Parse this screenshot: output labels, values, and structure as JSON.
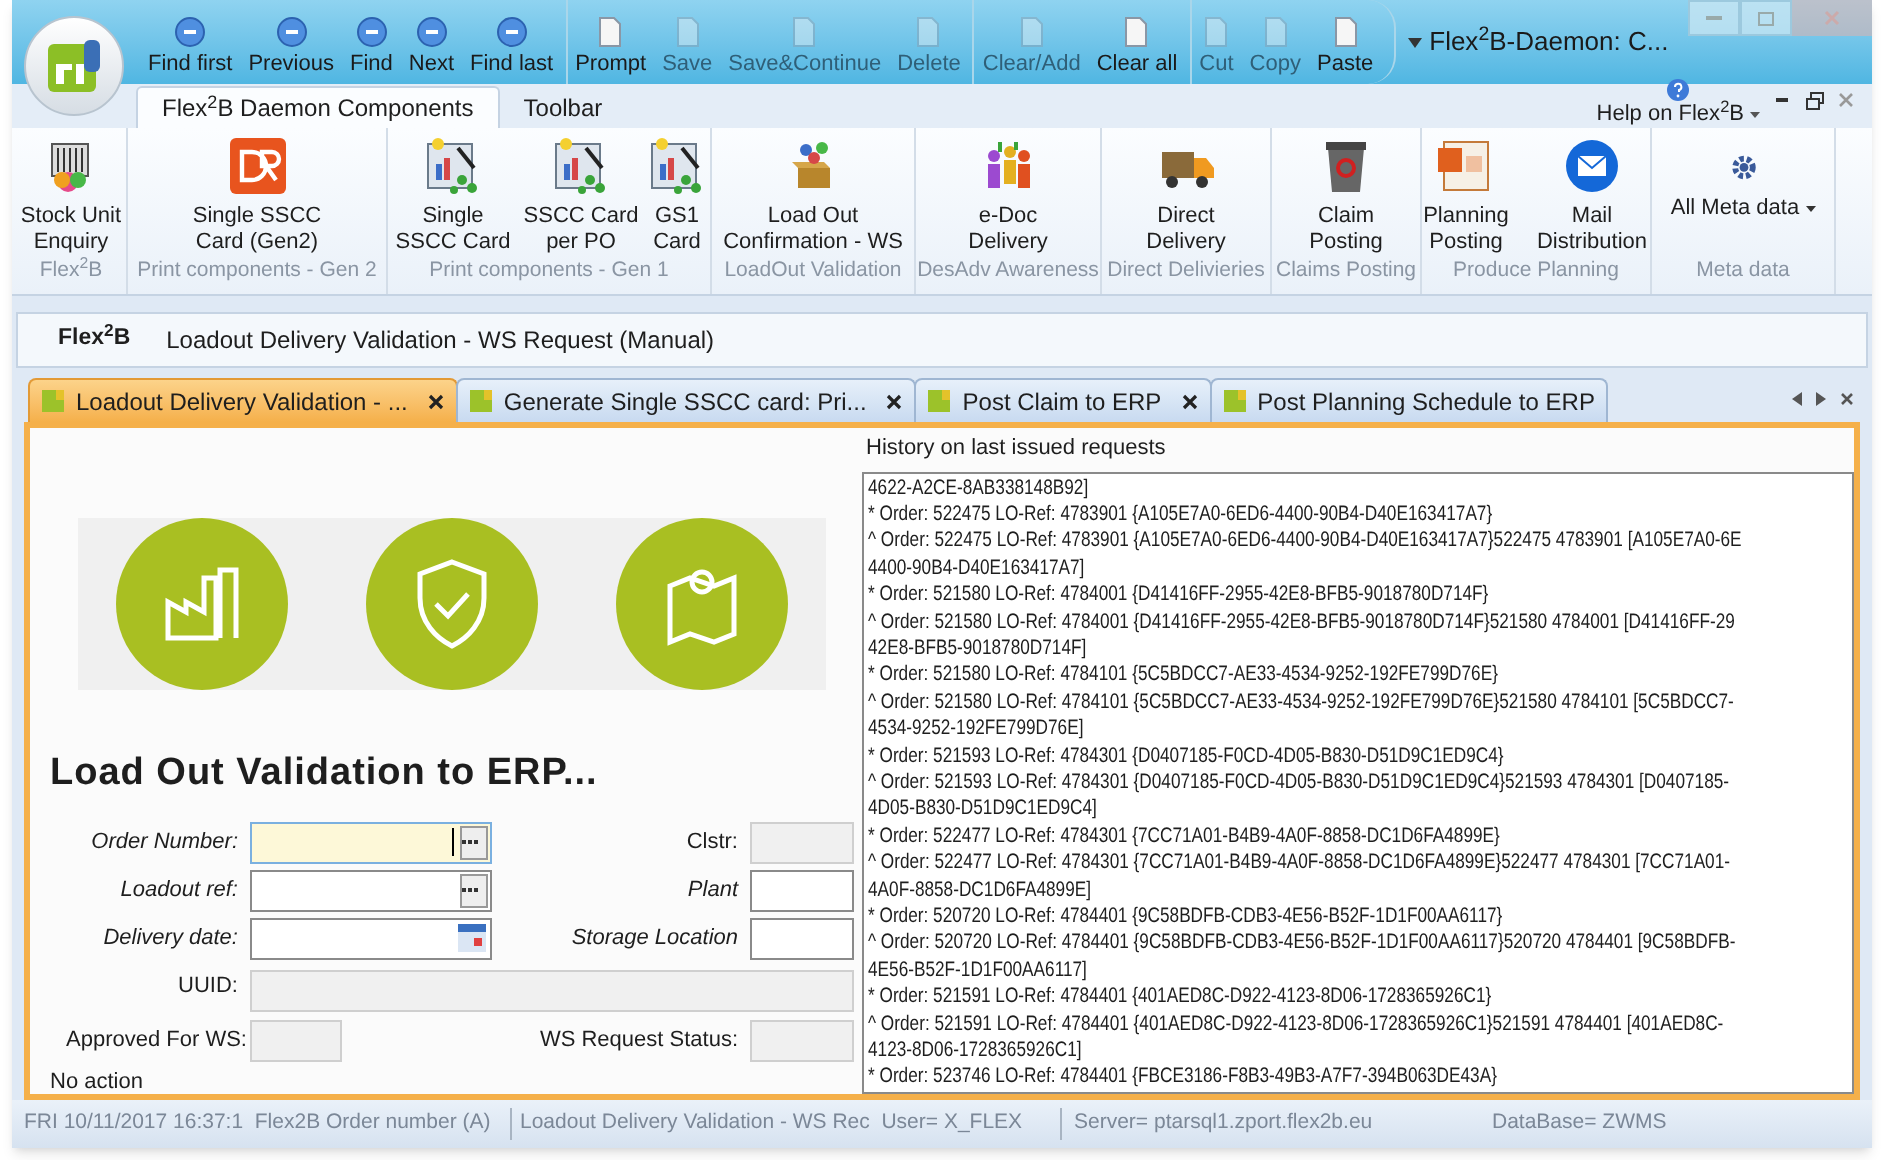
{
  "window": {
    "title": "Flex$^{2}$B-Daemon: C..."
  },
  "quick_access": [
    [
      {
        "label": "Find first",
        "disabled": false
      },
      {
        "label": "Previous",
        "disabled": false
      },
      {
        "label": "Find",
        "disabled": false
      },
      {
        "label": "Next",
        "disabled": false
      },
      {
        "label": "Find last",
        "disabled": false
      }
    ],
    [
      {
        "label": "Prompt",
        "disabled": false
      },
      {
        "label": "Save",
        "disabled": true
      },
      {
        "label": "Save&Continue",
        "disabled": true
      },
      {
        "label": "Delete",
        "disabled": true
      }
    ],
    [
      {
        "label": "Clear/Add",
        "disabled": true
      },
      {
        "label": "Clear all",
        "disabled": false
      }
    ],
    [
      {
        "label": "Cut",
        "disabled": true
      },
      {
        "label": "Copy",
        "disabled": true
      },
      {
        "label": "Paste",
        "disabled": false
      }
    ]
  ],
  "ribbon_tabs": [
    {
      "label": "Flex$^{2}$B Daemon Components",
      "selected": true
    },
    {
      "label": "Toolbar",
      "selected": false
    }
  ],
  "help": {
    "label": "Help on Flex$^{2}$B"
  },
  "ribbon_groups": [
    {
      "label": "Flex$^{2}$B",
      "buttons": [
        {
          "label": "Stock Unit Enquiry"
        }
      ]
    },
    {
      "label": "Print components - Gen 2",
      "buttons": [
        {
          "label": "Single SSCC Card (Gen2)"
        }
      ]
    },
    {
      "label": "Print components - Gen 1",
      "buttons": [
        {
          "label": "Single SSCC Card"
        },
        {
          "label": "SSCC Card per PO"
        },
        {
          "label": "GS1 Card"
        }
      ]
    },
    {
      "label": "LoadOut Validation",
      "buttons": [
        {
          "label": "Load Out Confirmation - WS"
        }
      ]
    },
    {
      "label": "DesAdv Awareness",
      "buttons": [
        {
          "label": "e-Doc Delivery"
        }
      ]
    },
    {
      "label": "Direct Delivieries",
      "buttons": [
        {
          "label": "Direct Delivery"
        }
      ]
    },
    {
      "label": "Claims Posting",
      "buttons": [
        {
          "label": "Claim Posting"
        }
      ]
    },
    {
      "label": "Produce Planning",
      "buttons": [
        {
          "label": "Planning Posting"
        },
        {
          "label": "Mail Distribution"
        }
      ]
    },
    {
      "label": "Meta data",
      "buttons": [
        {
          "label": "All Meta data",
          "dropdown": true
        }
      ]
    }
  ],
  "header": {
    "brand": "Flex$^{2}$B",
    "title": "Loadout Delivery Validation - WS Request (Manual)"
  },
  "doc_tabs": [
    {
      "label": "Loadout Delivery Validation - ...",
      "selected": true,
      "closable": true
    },
    {
      "label": "Generate Single SSCC card: Pri...",
      "selected": false,
      "closable": true
    },
    {
      "label": "Post Claim to ERP",
      "selected": false,
      "closable": true
    },
    {
      "label": "Post Planning Schedule to ERP",
      "selected": false,
      "closable": false
    }
  ],
  "form": {
    "title": "Load Out Validation to ERP...",
    "rows": [
      {
        "kind": "pair",
        "left": {
          "label": "Order Number:",
          "required": true,
          "kind": "lookup",
          "focused": true,
          "disabled": false
        },
        "right": {
          "label": "Clstr:",
          "required": false,
          "focused": false,
          "disabled": true
        }
      },
      {
        "kind": "pair",
        "left": {
          "label": "Loadout ref:",
          "required": true,
          "kind": "lookup",
          "focused": false,
          "disabled": false
        },
        "right": {
          "label": "Plant",
          "required": true,
          "focused": false,
          "disabled": false
        }
      },
      {
        "kind": "pair",
        "left": {
          "label": "Delivery date:",
          "required": true,
          "kind": "date",
          "focused": false,
          "disabled": false
        },
        "right": {
          "label": "Storage Location",
          "required": true,
          "focused": false,
          "disabled": false
        }
      },
      {
        "kind": "wide",
        "left": {
          "label": "UUID:",
          "required": false,
          "focused": false,
          "disabled": true
        }
      },
      {
        "kind": "short",
        "left": {
          "label": "Approved For WS:",
          "required": false,
          "focused": false,
          "disabled": true
        },
        "right": {
          "label": "WS Request Status:",
          "required": false,
          "focused": false,
          "disabled": true
        }
      }
    ],
    "status": "No action"
  },
  "history": {
    "label": "History on last issued requests",
    "lines": [
      "4622-A2CE-8AB338148B92]",
      "* Order: 522475 LO-Ref: 4783901 {A105E7A0-6ED6-4400-90B4-D40E163417A7}",
      "^ Order: 522475 LO-Ref: 4783901 {A105E7A0-6ED6-4400-90B4-D40E163417A7}522475 4783901 [A105E7A0-6E",
      "4400-90B4-D40E163417A7]",
      "* Order: 521580 LO-Ref: 4784001 {D41416FF-2955-42E8-BFB5-9018780D714F}",
      "^ Order: 521580 LO-Ref: 4784001 {D41416FF-2955-42E8-BFB5-9018780D714F}521580 4784001 [D41416FF-29",
      "42E8-BFB5-9018780D714F]",
      "* Order: 521580 LO-Ref: 4784101 {5C5BDCC7-AE33-4534-9252-192FE799D76E}",
      "^ Order: 521580 LO-Ref: 4784101 {5C5BDCC7-AE33-4534-9252-192FE799D76E}521580 4784101 [5C5BDCC7-",
      "4534-9252-192FE799D76E]",
      "* Order: 521593 LO-Ref: 4784301 {D0407185-F0CD-4D05-B830-D51D9C1ED9C4}",
      "^ Order: 521593 LO-Ref: 4784301 {D0407185-F0CD-4D05-B830-D51D9C1ED9C4}521593 4784301 [D0407185-",
      "4D05-B830-D51D9C1ED9C4]",
      "* Order: 522477 LO-Ref: 4784301 {7CC71A01-B4B9-4A0F-8858-DC1D6FA4899E}",
      "^ Order: 522477 LO-Ref: 4784301 {7CC71A01-B4B9-4A0F-8858-DC1D6FA4899E}522477 4784301 [7CC71A01-",
      "4A0F-8858-DC1D6FA4899E]",
      "* Order: 520720 LO-Ref: 4784401 {9C58BDFB-CDB3-4E56-B52F-1D1F00AA6117}",
      "^ Order: 520720 LO-Ref: 4784401 {9C58BDFB-CDB3-4E56-B52F-1D1F00AA6117}520720 4784401 [9C58BDFB-",
      "4E56-B52F-1D1F00AA6117]",
      "* Order: 521591 LO-Ref: 4784401 {401AED8C-D922-4123-8D06-1728365926C1}",
      "^ Order: 521591 LO-Ref: 4784401 {401AED8C-D922-4123-8D06-1728365926C1}521591 4784401 [401AED8C-",
      "4123-8D06-1728365926C1]",
      "* Order: 523746 LO-Ref: 4784401 {FBCE3186-F8B3-49B3-A7F7-394B063DE43A}"
    ]
  },
  "status_bar": [
    "FRI 10/11/2017 16:37:1  Flex2B Order number (A)",
    "Loadout Delivery Validation - WS Rec  User= X_FLEX",
    "Server= ptarsql1.zport.flex2b.eu",
    "DataBase= ZWMS"
  ]
}
